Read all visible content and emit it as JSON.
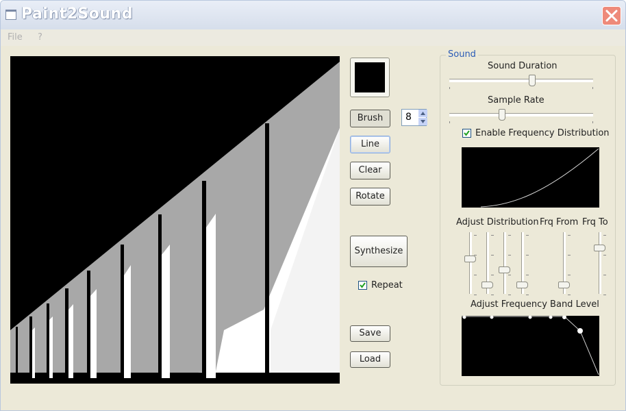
{
  "window": {
    "title": "Paint2Sound"
  },
  "menu": {
    "file": "File",
    "help": "?"
  },
  "tools": {
    "brush_label": "Brush",
    "brush_size": "8",
    "line_label": "Line",
    "clear_label": "Clear",
    "rotate_label": "Rotate",
    "synthesize_label": "Synthesize",
    "repeat_label": "Repeat",
    "repeat_checked": true,
    "save_label": "Save",
    "load_label": "Load",
    "brush_color": "#000000"
  },
  "sound": {
    "group_label": "Sound",
    "duration_label": "Sound Duration",
    "duration_level": 0.58,
    "sample_rate_label": "Sample Rate",
    "sample_rate_level": 0.36,
    "enable_freq_label": "Enable Frequency Distribution",
    "enable_freq_checked": true,
    "adjust_distribution_label": "Adjust Distribution",
    "frq_from_label": "Frq From",
    "frq_to_label": "Frq To",
    "adjust_band_label": "Adjust Frequency Band Level",
    "distribution_levels": [
      0.58,
      0.1,
      0.38,
      0.1
    ],
    "frq_from_level": 0.1,
    "frq_to_level": 0.78
  },
  "icons": {
    "app": "window-icon",
    "close": "close-icon",
    "spin_up": "arrow-up-icon",
    "spin_down": "arrow-down-icon",
    "check": "check-icon"
  }
}
